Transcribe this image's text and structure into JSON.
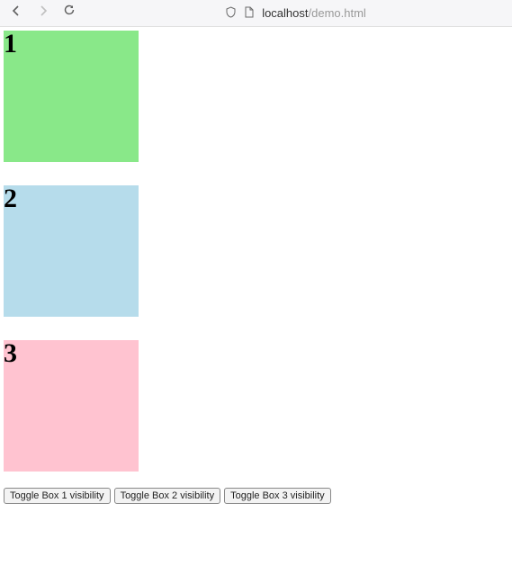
{
  "browser": {
    "url_host": "localhost",
    "url_path": "/demo.html"
  },
  "boxes": [
    {
      "label": "1",
      "color": "#89e889"
    },
    {
      "label": "2",
      "color": "#b6dceb"
    },
    {
      "label": "3",
      "color": "#ffc3d0"
    }
  ],
  "buttons": {
    "toggle1": "Toggle Box 1 visibility",
    "toggle2": "Toggle Box 2 visibility",
    "toggle3": "Toggle Box 3 visibility"
  }
}
